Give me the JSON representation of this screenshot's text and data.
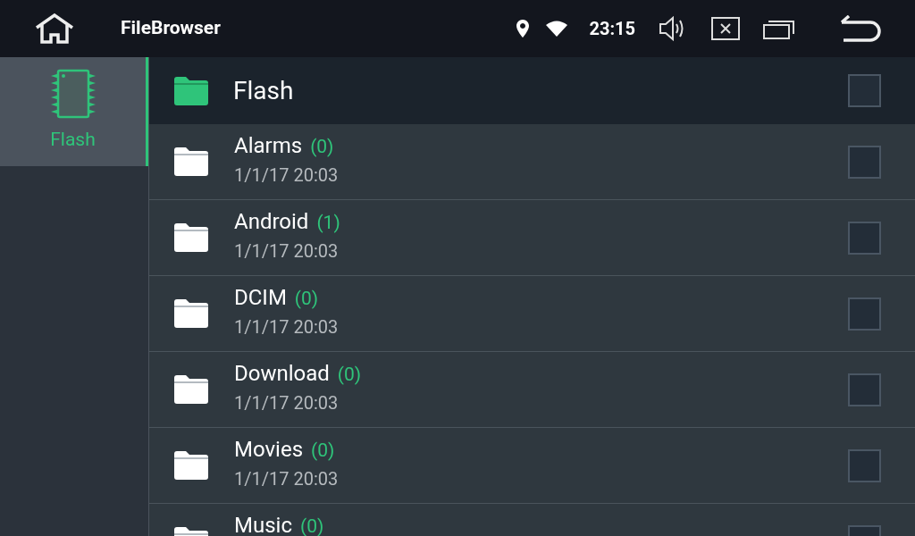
{
  "status_bar": {
    "title": "FileBrowser",
    "time": "23:15"
  },
  "sidebar": {
    "items": [
      {
        "label": "Flash",
        "selected": true
      }
    ]
  },
  "header": {
    "title": "Flash",
    "checked": false
  },
  "files": [
    {
      "name": "Alarms",
      "count": "(0)",
      "date": "1/1/17 20:03",
      "checked": false
    },
    {
      "name": "Android",
      "count": "(1)",
      "date": "1/1/17 20:03",
      "checked": false
    },
    {
      "name": "DCIM",
      "count": "(0)",
      "date": "1/1/17 20:03",
      "checked": false
    },
    {
      "name": "Download",
      "count": "(0)",
      "date": "1/1/17 20:03",
      "checked": false
    },
    {
      "name": "Movies",
      "count": "(0)",
      "date": "1/1/17 20:03",
      "checked": false
    },
    {
      "name": "Music",
      "count": "(0)",
      "checked": false
    }
  ]
}
